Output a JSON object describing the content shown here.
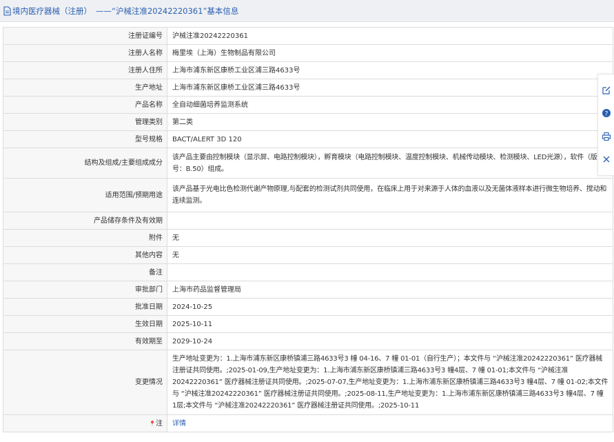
{
  "header": {
    "link_text": "境内医疗器械（注册）",
    "title": "——“沪械注准20242220361”基本信息"
  },
  "rows": [
    {
      "label": "注册证编号",
      "value": "沪械注准20242220361"
    },
    {
      "label": "注册人名称",
      "value": "梅里埃（上海）生物制品有限公司"
    },
    {
      "label": "注册人住所",
      "value": "上海市浦东新区康桥工业区浦三路4633号"
    },
    {
      "label": "生产地址",
      "value": "上海市浦东新区康桥工业区浦三路4633号"
    },
    {
      "label": "产品名称",
      "value": "全自动细菌培养监测系统"
    },
    {
      "label": "管理类别",
      "value": "第二类"
    },
    {
      "label": "型号规格",
      "value": "BACT/ALERT 3D 120"
    },
    {
      "label": "结构及组成/主要组成成分",
      "value": "该产品主要由控制模块（显示屏、电路控制模块），孵育模块（电路控制模块、温度控制模块、机械传动模块、检测模块、LED光源），软件（版本号：B.50）组成。"
    },
    {
      "label": "适用范围/预期用途",
      "value": "该产品基于光电比色检测代谢产物原理,与配套的检测试剂共同使用，在临床上用于对来源于人体的血液以及无菌体液样本进行微生物培养、搅动和连续监测。"
    },
    {
      "label": "产品储存条件及有效期",
      "value": ""
    },
    {
      "label": "附件",
      "value": "无"
    },
    {
      "label": "其他内容",
      "value": "无"
    },
    {
      "label": "备注",
      "value": ""
    },
    {
      "label": "审批部门",
      "value": "上海市药品监督管理局"
    },
    {
      "label": "批准日期",
      "value": "2024-10-25"
    },
    {
      "label": "生效日期",
      "value": "2025-10-11"
    },
    {
      "label": "有效期至",
      "value": "2029-10-24"
    },
    {
      "label": "变更情况",
      "value": "生产地址变更为：1.上海市浦东新区康桥镇浦三路4633号3 幢 04-16、7 幢 01-01（自行生产）；本文件与 “沪械注准20242220361” 医疗器械注册证共同使用。;2025-01-09,生产地址变更为：1.上海市浦东新区康桥镇浦三路4633号3 幢4层、7 幢 01-01;本文件与 “沪械注准20242220361” 医疗器械注册证共同使用。;2025-07-07,生产地址变更为：1.上海市浦东新区康桥镇浦三路4633号3 幢4层、7 幢 01-02;本文件与 “沪械注准20242220361” 医疗器械注册证共同使用。;2025-08-11,生产地址变更为：1.上海市浦东新区康桥镇浦三路4633号3 幢4层、7 幢 1层;本文件与 “沪械注准20242220361” 医疗器械注册证共同使用。;2025-10-11"
    }
  ],
  "note_row": {
    "label": "注",
    "link": "详情"
  },
  "icons": {
    "header": "document-icon",
    "note": "pin-icon",
    "sidebar": [
      "edit-icon",
      "help-icon",
      "print-icon",
      "close-icon"
    ]
  },
  "colors": {
    "link": "#2a5fb0",
    "header_bg": "#eef0f3",
    "label_bg": "#f7f7f7",
    "border": "#dcdcdc"
  }
}
